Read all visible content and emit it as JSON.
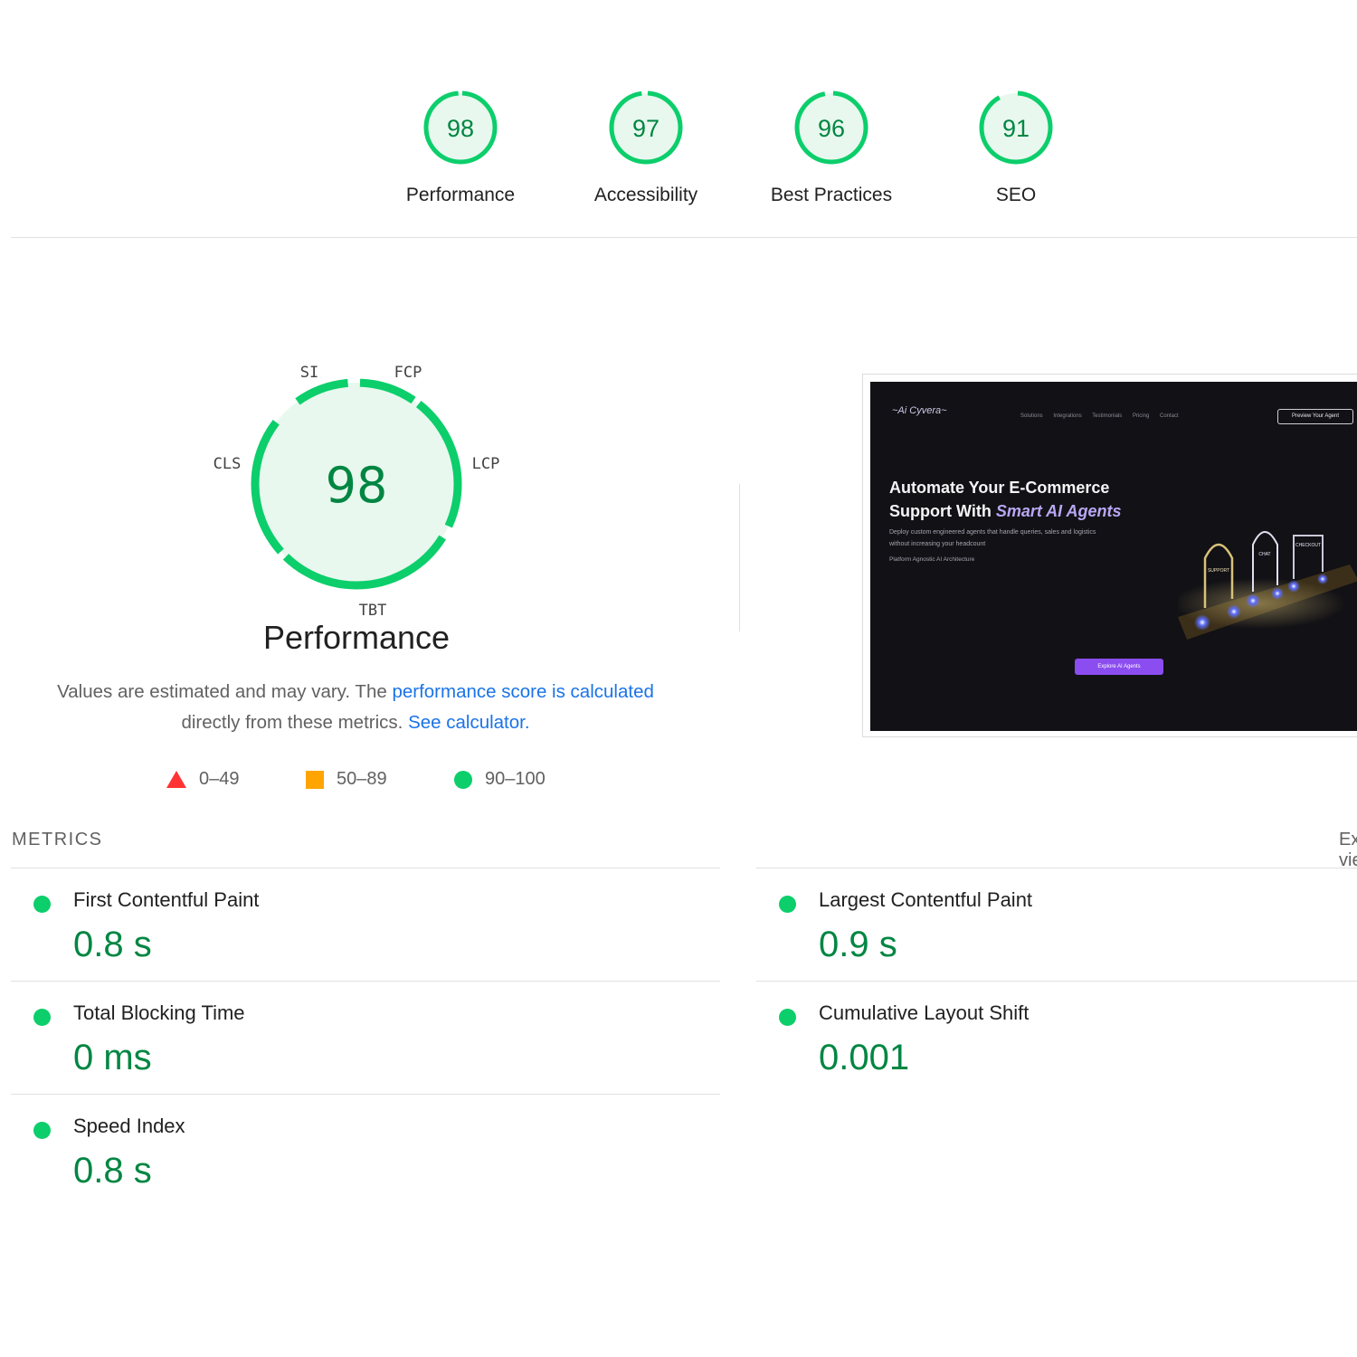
{
  "summary": {
    "gauges": [
      {
        "score": "98",
        "label": "Performance"
      },
      {
        "score": "97",
        "label": "Accessibility"
      },
      {
        "score": "96",
        "label": "Best Practices"
      },
      {
        "score": "91",
        "label": "SEO"
      }
    ]
  },
  "performance": {
    "score": "98",
    "title": "Performance",
    "segment_labels": {
      "si": "SI",
      "fcp": "FCP",
      "lcp": "LCP",
      "tbt": "TBT",
      "cls": "CLS"
    },
    "desc_text_1": "Values are estimated and may vary. The ",
    "desc_link_1": "performance score is calculated",
    "desc_text_2": " directly from these metrics. ",
    "desc_link_2": "See calculator.",
    "legend": {
      "fail": "0–49",
      "average": "50–89",
      "pass": "90–100"
    }
  },
  "colors": {
    "pass": "#0cce6b",
    "pass_bg": "#e8f8ee",
    "pass_text": "#018642",
    "average": "#ffa400",
    "fail": "#ff3333",
    "link": "#1a73e8"
  },
  "screenshot": {
    "logo": "~Ai Cyvera~",
    "nav": [
      "Solutions",
      "Integrations",
      "Testimonials",
      "Pricing",
      "Contact"
    ],
    "cta": "Preview Your Agent",
    "headline_1": "Automate Your E-Commerce",
    "headline_2": "Support With ",
    "headline_em": "Smart AI Agents",
    "sub": "Deploy custom engineered agents that handle queries, sales and logistics without increasing your headcount",
    "sub2": "Platform Agnostic AI Architecture",
    "explore": "Explore AI Agents",
    "scene_labels": [
      "SUPPORT",
      "CHAT",
      "CHECKOUT"
    ]
  },
  "metrics": {
    "header": "METRICS",
    "expand": "Expand view",
    "items": [
      {
        "title": "First Contentful Paint",
        "value": "0.8 s"
      },
      {
        "title": "Largest Contentful Paint",
        "value": "0.9 s"
      },
      {
        "title": "Total Blocking Time",
        "value": "0 ms"
      },
      {
        "title": "Cumulative Layout Shift",
        "value": "0.001"
      },
      {
        "title": "Speed Index",
        "value": "0.8 s"
      }
    ]
  }
}
